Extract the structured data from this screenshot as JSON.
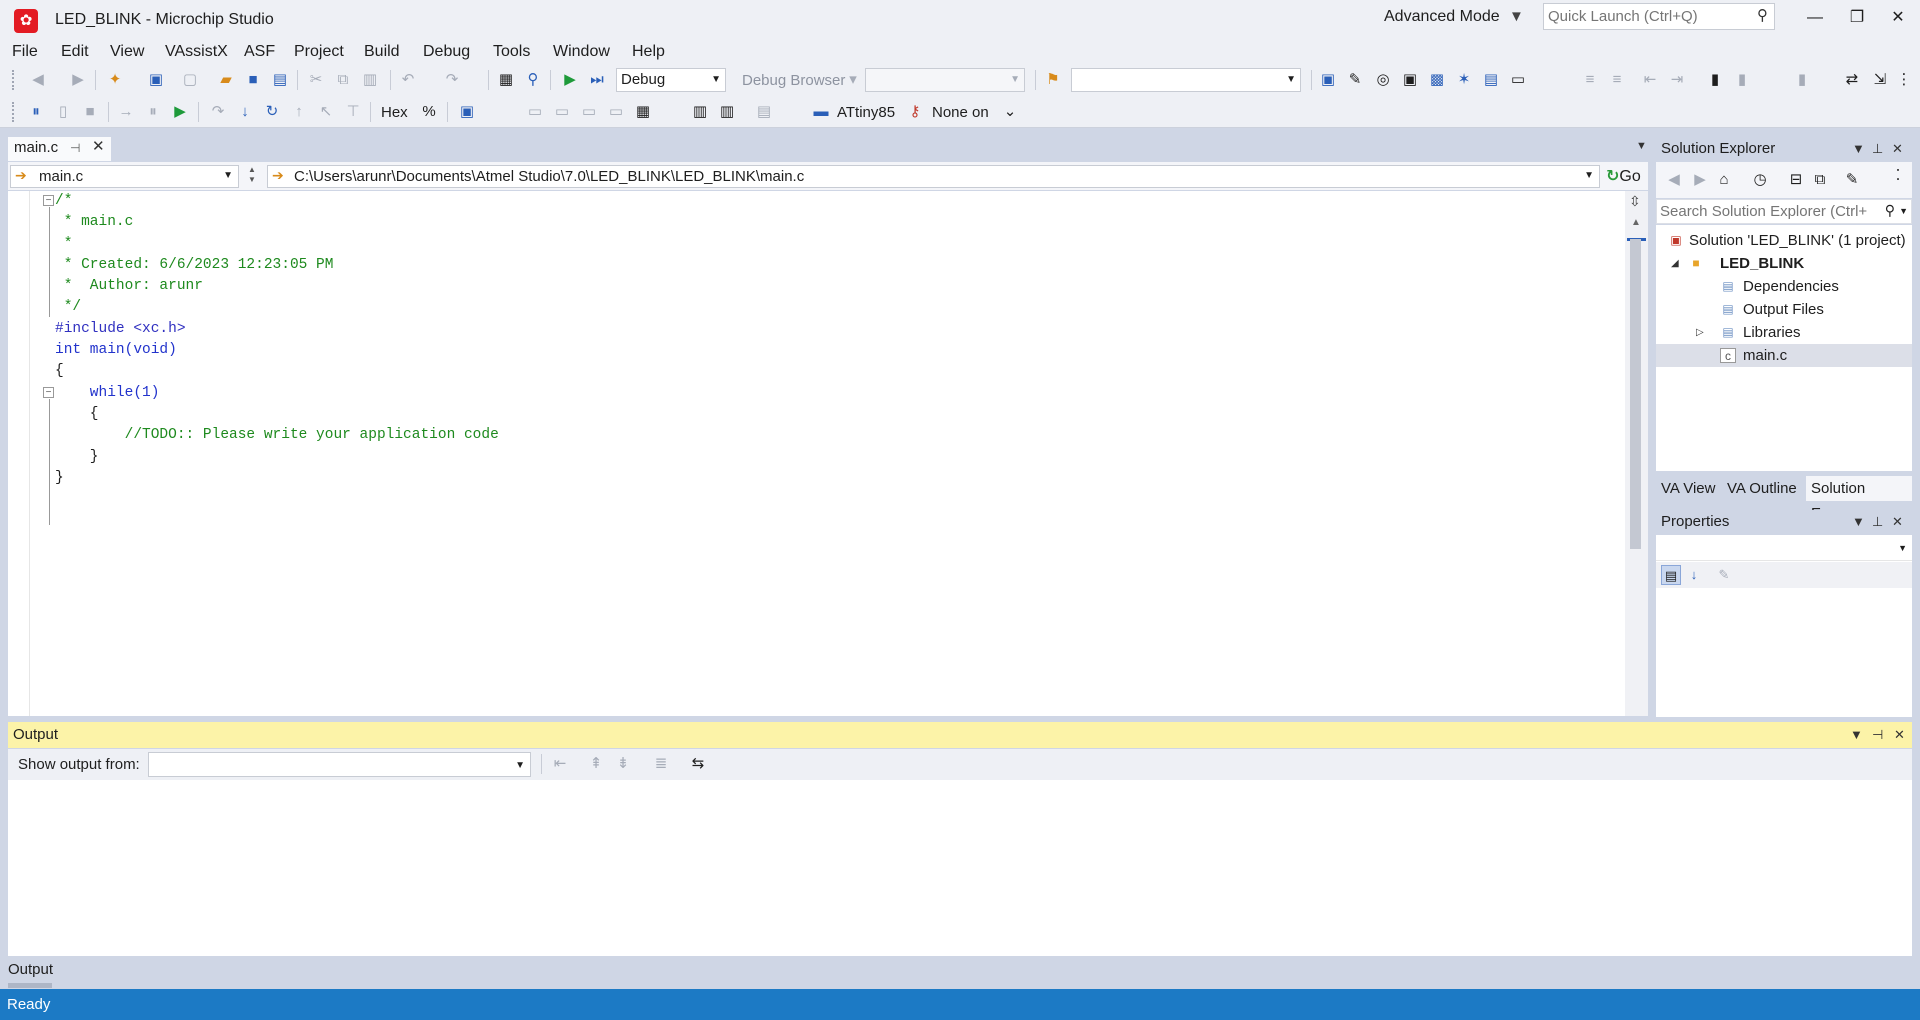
{
  "window": {
    "title": "LED_BLINK - Microchip Studio",
    "mode": "Advanced Mode",
    "quick_launch_placeholder": "Quick Launch (Ctrl+Q)",
    "controls": [
      "minimize-icon",
      "restore-icon",
      "close-icon"
    ]
  },
  "menu": [
    "File",
    "Edit",
    "View",
    "VAssistX",
    "ASF",
    "Project",
    "Build",
    "Debug",
    "Tools",
    "Window",
    "Help"
  ],
  "toolbar": {
    "config_value": "Debug",
    "debug_browser_label": "Debug Browser",
    "hex_label": "Hex",
    "device_label": "ATtiny85",
    "tool_label": "None on"
  },
  "editor": {
    "tab_label": "main.c",
    "nav_scope": "main.c",
    "path": "C:\\Users\\arunr\\Documents\\Atmel Studio\\7.0\\LED_BLINK\\LED_BLINK\\main.c",
    "go_label": "Go",
    "lines": [
      "/*",
      " * main.c",
      " *",
      " * Created: 6/6/2023 12:23:05 PM",
      " *  Author: arunr",
      " */",
      "",
      "#include <xc.h>",
      "",
      "int main(void)",
      "{",
      "    while(1)",
      "    {",
      "        //TODO:: Please write your application code",
      "    }",
      "}"
    ]
  },
  "solution_explorer": {
    "title": "Solution Explorer",
    "search_placeholder": "Search Solution Explorer (Ctrl+",
    "tree": {
      "solution": "Solution 'LED_BLINK' (1 project)",
      "project": "LED_BLINK",
      "items": [
        "Dependencies",
        "Output Files",
        "Libraries",
        "main.c"
      ]
    },
    "tabs": [
      "VA View",
      "VA Outline",
      "Solution Exp..."
    ]
  },
  "properties": {
    "title": "Properties"
  },
  "output": {
    "title": "Output",
    "show_from_label": "Show output from:",
    "show_from_value": "",
    "bottom_tab": "Output"
  },
  "status": {
    "text": "Ready",
    "bar_color": "#1c7ac5"
  }
}
